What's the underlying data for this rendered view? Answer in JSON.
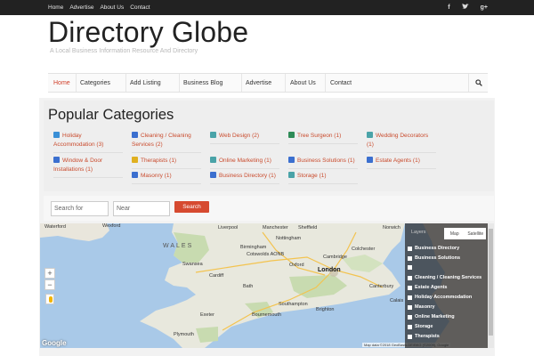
{
  "topbar": {
    "links": [
      "Home",
      "Advertise",
      "About Us",
      "Contact"
    ],
    "social_icons": [
      "facebook-icon",
      "twitter-icon",
      "google-plus-icon"
    ]
  },
  "header": {
    "title": "Directory Globe",
    "tagline": "A Local Business Information Resource And Directory"
  },
  "nav": {
    "items": [
      "Home",
      "Categories",
      "Add Listing",
      "Business Blog",
      "Advertise",
      "About Us",
      "Contact"
    ],
    "search_icon": "search-icon",
    "accent": "#d0402b"
  },
  "categories": {
    "title": "Popular Categories",
    "items": [
      {
        "label": "Holiday Accommodation (3)",
        "icon": "bed-icon",
        "color": "#3a8fd6"
      },
      {
        "label": "Cleaning / Cleaning Services (2)",
        "icon": "broom-icon",
        "color": "#3b6fcf"
      },
      {
        "label": "Web Design (2)",
        "icon": "monitor-icon",
        "color": "#4aa3a8"
      },
      {
        "label": "Tree Surgeon (1)",
        "icon": "tree-icon",
        "color": "#2e8b57"
      },
      {
        "label": "Wedding Decorators (1)",
        "icon": "rings-icon",
        "color": "#4aa3a8"
      },
      {
        "label": "Window & Door Installations (1)",
        "icon": "window-icon",
        "color": "#3b6fcf"
      },
      {
        "label": "Therapists (1)",
        "icon": "therapy-icon",
        "color": "#e0b020"
      },
      {
        "label": "Online Marketing (1)",
        "icon": "chart-icon",
        "color": "#4aa3a8"
      },
      {
        "label": "Business Solutions (1)",
        "icon": "briefcase-icon",
        "color": "#3b6fcf"
      },
      {
        "label": "Estate Agents (1)",
        "icon": "house-icon",
        "color": "#3b6fcf"
      },
      {
        "label": "Masonry (1)",
        "icon": "brick-icon",
        "color": "#3b6fcf"
      },
      {
        "label": "Business Directory (1)",
        "icon": "directory-icon",
        "color": "#3b6fcf"
      },
      {
        "label": "Storage (1)",
        "icon": "box-icon",
        "color": "#4aa3a8"
      }
    ]
  },
  "search": {
    "for_placeholder": "Search for",
    "near_placeholder": "Near",
    "button": "Search"
  },
  "map": {
    "region_label": "WALES",
    "places": [
      "Waterford",
      "Wexford",
      "Liverpool",
      "Manchester",
      "Sheffield",
      "Nottingham",
      "Norwich",
      "Cambridge",
      "Birmingham",
      "Colchester",
      "Oxford",
      "London",
      "Swansea",
      "Cardiff",
      "Bath",
      "Cotswolds AONB",
      "Southampton",
      "Brighton",
      "Canterbury",
      "Bournemouth",
      "Exeter",
      "Plymouth",
      "Calais"
    ],
    "zoom_in": "+",
    "zoom_out": "−",
    "attribution": "Map data ©2018 GeoBasis-DE/BKG (©2009), Google",
    "logo": "Google",
    "map_type": [
      "Map",
      "Satellite"
    ],
    "layers_title": "Layers",
    "layers": [
      "Business Directory",
      "Business Solutions",
      "",
      "Cleaning / Cleaning Services",
      "Estate Agents",
      "Holiday Accommodation",
      "Masonry",
      "Online Marketing",
      "Storage",
      "Therapists"
    ]
  }
}
